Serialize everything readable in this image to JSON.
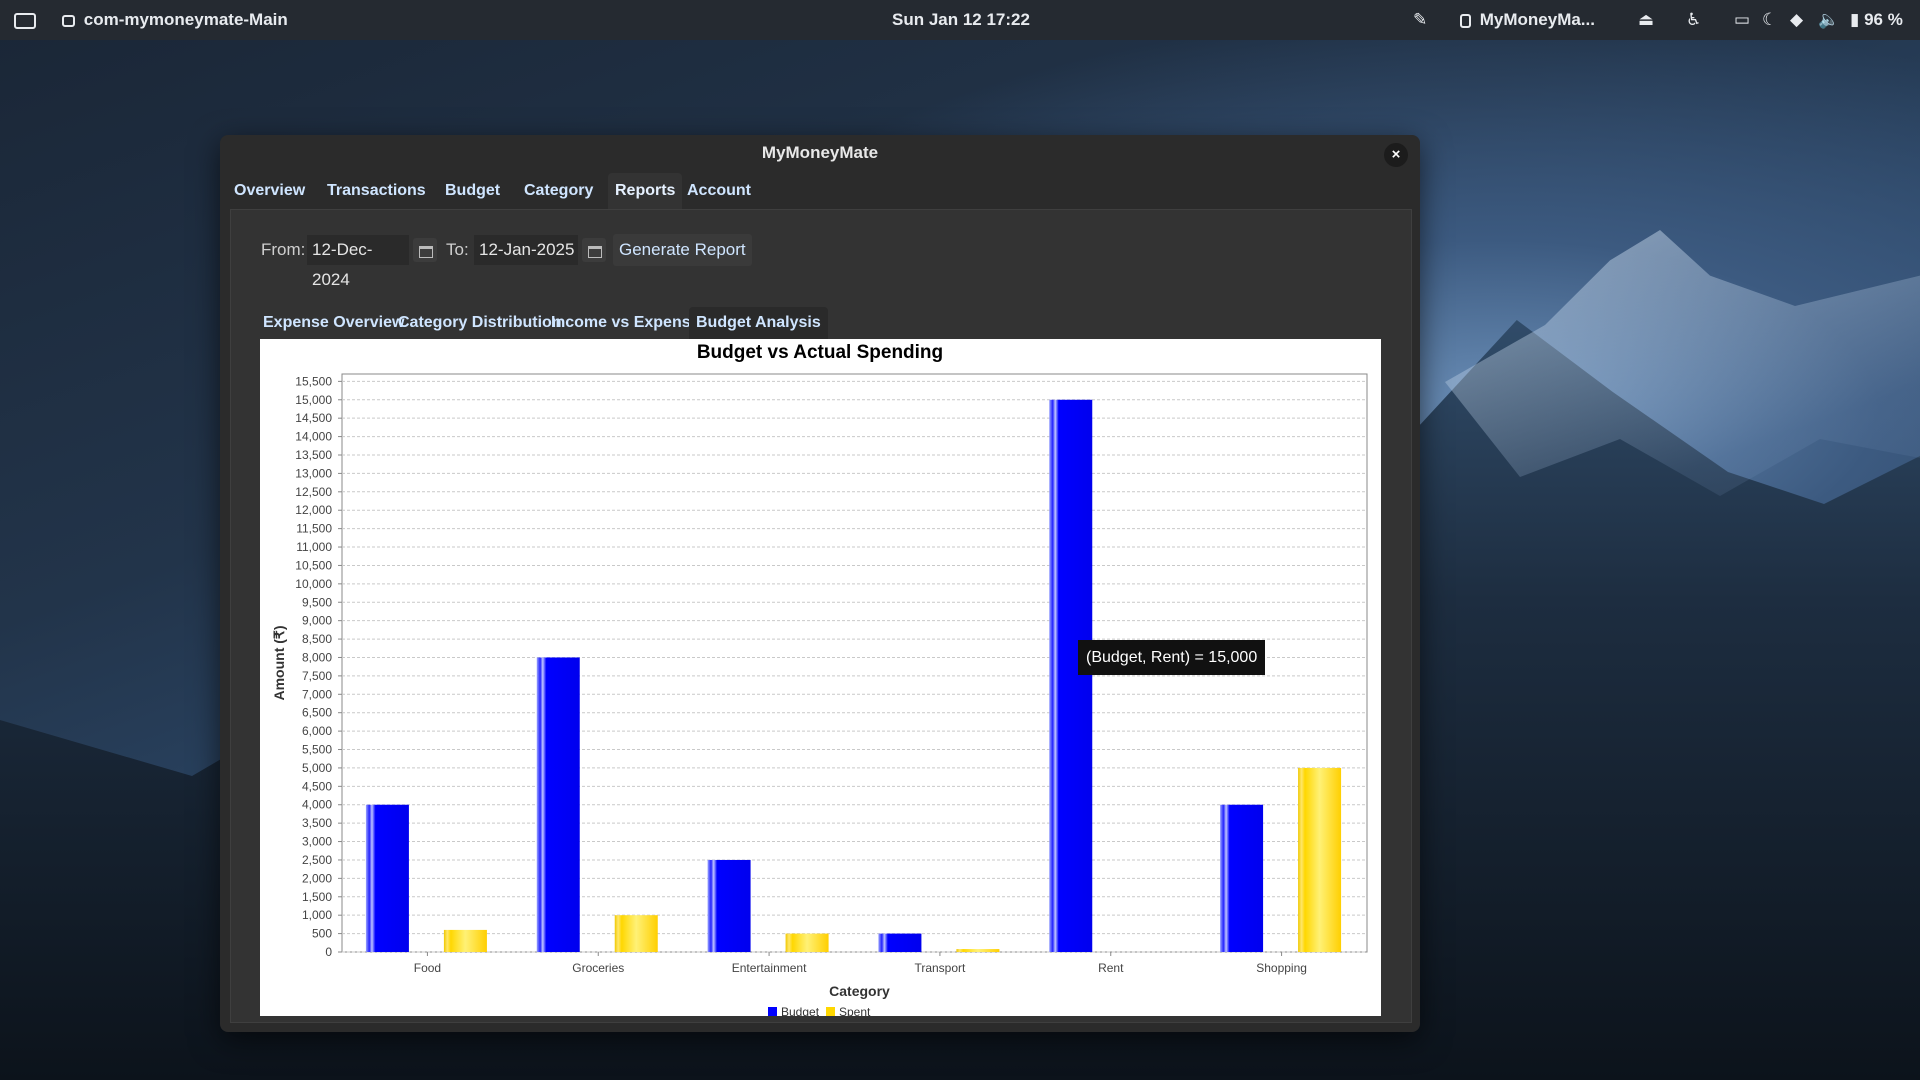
{
  "topbar": {
    "app_name": "com-mymoneymate-Main",
    "datetime": "Sun Jan 12  17:22",
    "active_window": "MyMoneyMa...",
    "battery": "96 %"
  },
  "window": {
    "title": "MyMoneyMate",
    "close": "×",
    "tabs": [
      "Overview",
      "Transactions",
      "Budget",
      "Category",
      "Reports",
      "Account"
    ],
    "active_tab": "Reports"
  },
  "filters": {
    "from_label": "From:",
    "from_value": "12-Dec-2024",
    "to_label": "To:",
    "to_value": "12-Jan-2025",
    "generate_button": "Generate Report"
  },
  "report_tabs": [
    "Expense Overview",
    "Category Distribution",
    "Income vs Expenses",
    "Budget Analysis"
  ],
  "active_report_tab": "Budget Analysis",
  "tooltip": "(Budget, Rent) = 15,000",
  "chart_data": {
    "type": "bar",
    "title": "Budget vs Actual Spending",
    "xlabel": "Category",
    "ylabel": "Amount (₹)",
    "categories": [
      "Food",
      "Groceries",
      "Entertainment",
      "Transport",
      "Rent",
      "Shopping"
    ],
    "series": [
      {
        "name": "Budget",
        "values": [
          4000,
          8000,
          2500,
          500,
          15000,
          4000
        ],
        "color": "#0000ff"
      },
      {
        "name": "Spent",
        "values": [
          600,
          1000,
          500,
          80,
          0,
          5000
        ],
        "color": "#ffd700"
      }
    ],
    "ylim": [
      0,
      15700
    ],
    "ytick_step": 500,
    "grid": true,
    "legend": "bottom-center"
  }
}
